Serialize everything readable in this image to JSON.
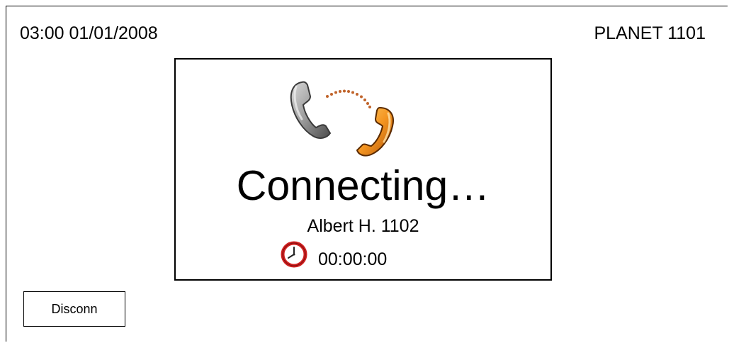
{
  "header": {
    "datetime": "03:00 01/01/2008",
    "extension": "PLANET 1101"
  },
  "call": {
    "icon": "phone-call-icon",
    "status": "Connecting…",
    "contact": "Albert H. 1102",
    "timer_icon": "clock-icon",
    "timer": "00:00:00"
  },
  "actions": {
    "disconnect_label": "Disconn"
  },
  "colors": {
    "border": "#000000",
    "background": "#ffffff",
    "handset_gray": "#8a8a8a",
    "handset_orange": "#f08a1c",
    "signal_dots": "#c0632a",
    "clock_red": "#d01f1f"
  }
}
